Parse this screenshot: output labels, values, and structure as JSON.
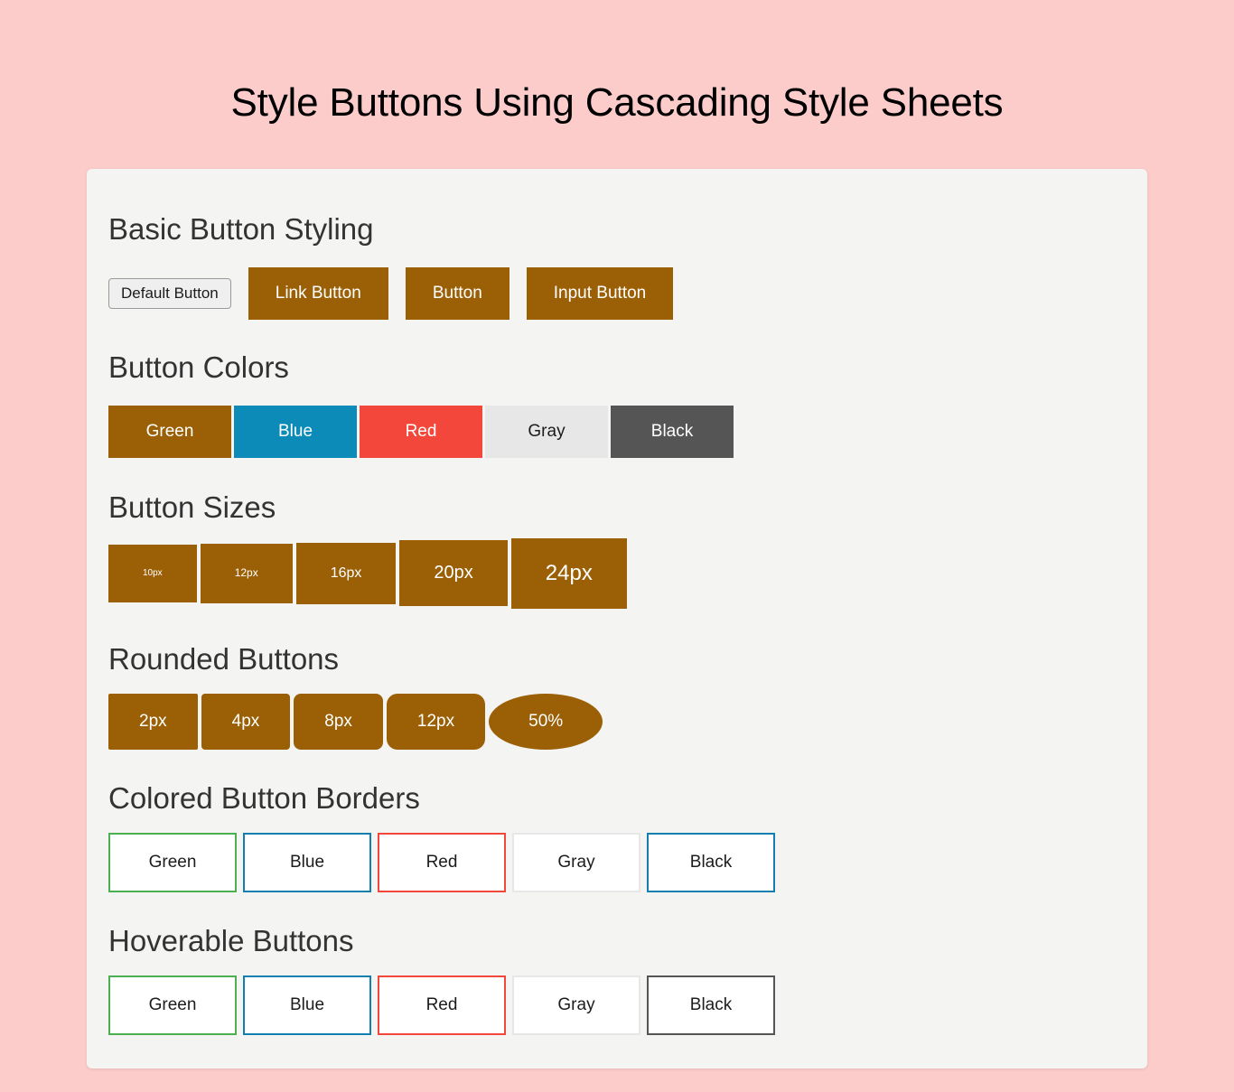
{
  "page": {
    "title": "Style Buttons Using Cascading Style Sheets",
    "background_color": "#fccccb",
    "card_background": "#f4f4f3"
  },
  "theme": {
    "primary": "#9b6006",
    "blue": "#0c8bb8",
    "red": "#f2473a",
    "gray": "#e7e7e7",
    "black": "#555555",
    "green_border": "#4caf50"
  },
  "sections": {
    "basic": {
      "heading": "Basic Button Styling",
      "buttons": [
        {
          "label": "Default Button",
          "style": "default"
        },
        {
          "label": "Link Button",
          "style": "brown"
        },
        {
          "label": "Button",
          "style": "brown"
        },
        {
          "label": "Input Button",
          "style": "brown"
        }
      ]
    },
    "colors": {
      "heading": "Button Colors",
      "buttons": [
        {
          "label": "Green",
          "color": "#9b6006"
        },
        {
          "label": "Blue",
          "color": "#0c8bb8"
        },
        {
          "label": "Red",
          "color": "#f2473a"
        },
        {
          "label": "Gray",
          "color": "#e7e7e7"
        },
        {
          "label": "Black",
          "color": "#555555"
        }
      ]
    },
    "sizes": {
      "heading": "Button Sizes",
      "buttons": [
        {
          "label": "10px",
          "font_size": "10px"
        },
        {
          "label": "12px",
          "font_size": "12px"
        },
        {
          "label": "16px",
          "font_size": "16px"
        },
        {
          "label": "20px",
          "font_size": "20px"
        },
        {
          "label": "24px",
          "font_size": "24px"
        }
      ]
    },
    "rounded": {
      "heading": "Rounded Buttons",
      "buttons": [
        {
          "label": "2px",
          "radius": "2px"
        },
        {
          "label": "4px",
          "radius": "4px"
        },
        {
          "label": "8px",
          "radius": "8px"
        },
        {
          "label": "12px",
          "radius": "12px"
        },
        {
          "label": "50%",
          "radius": "50%"
        }
      ]
    },
    "bordered": {
      "heading": "Colored Button Borders",
      "buttons": [
        {
          "label": "Green",
          "border_color": "#4caf50"
        },
        {
          "label": "Blue",
          "border_color": "#1180b0"
        },
        {
          "label": "Red",
          "border_color": "#f2473a"
        },
        {
          "label": "Gray",
          "border_color": "#e7e7e7"
        },
        {
          "label": "Black",
          "border_color": "#1180b0"
        }
      ]
    },
    "hoverable": {
      "heading": "Hoverable Buttons",
      "buttons": [
        {
          "label": "Green",
          "border_color": "#4caf50"
        },
        {
          "label": "Blue",
          "border_color": "#1180b0"
        },
        {
          "label": "Red",
          "border_color": "#f2473a"
        },
        {
          "label": "Gray",
          "border_color": "#e7e7e7"
        },
        {
          "label": "Black",
          "border_color": "#555555"
        }
      ]
    }
  }
}
